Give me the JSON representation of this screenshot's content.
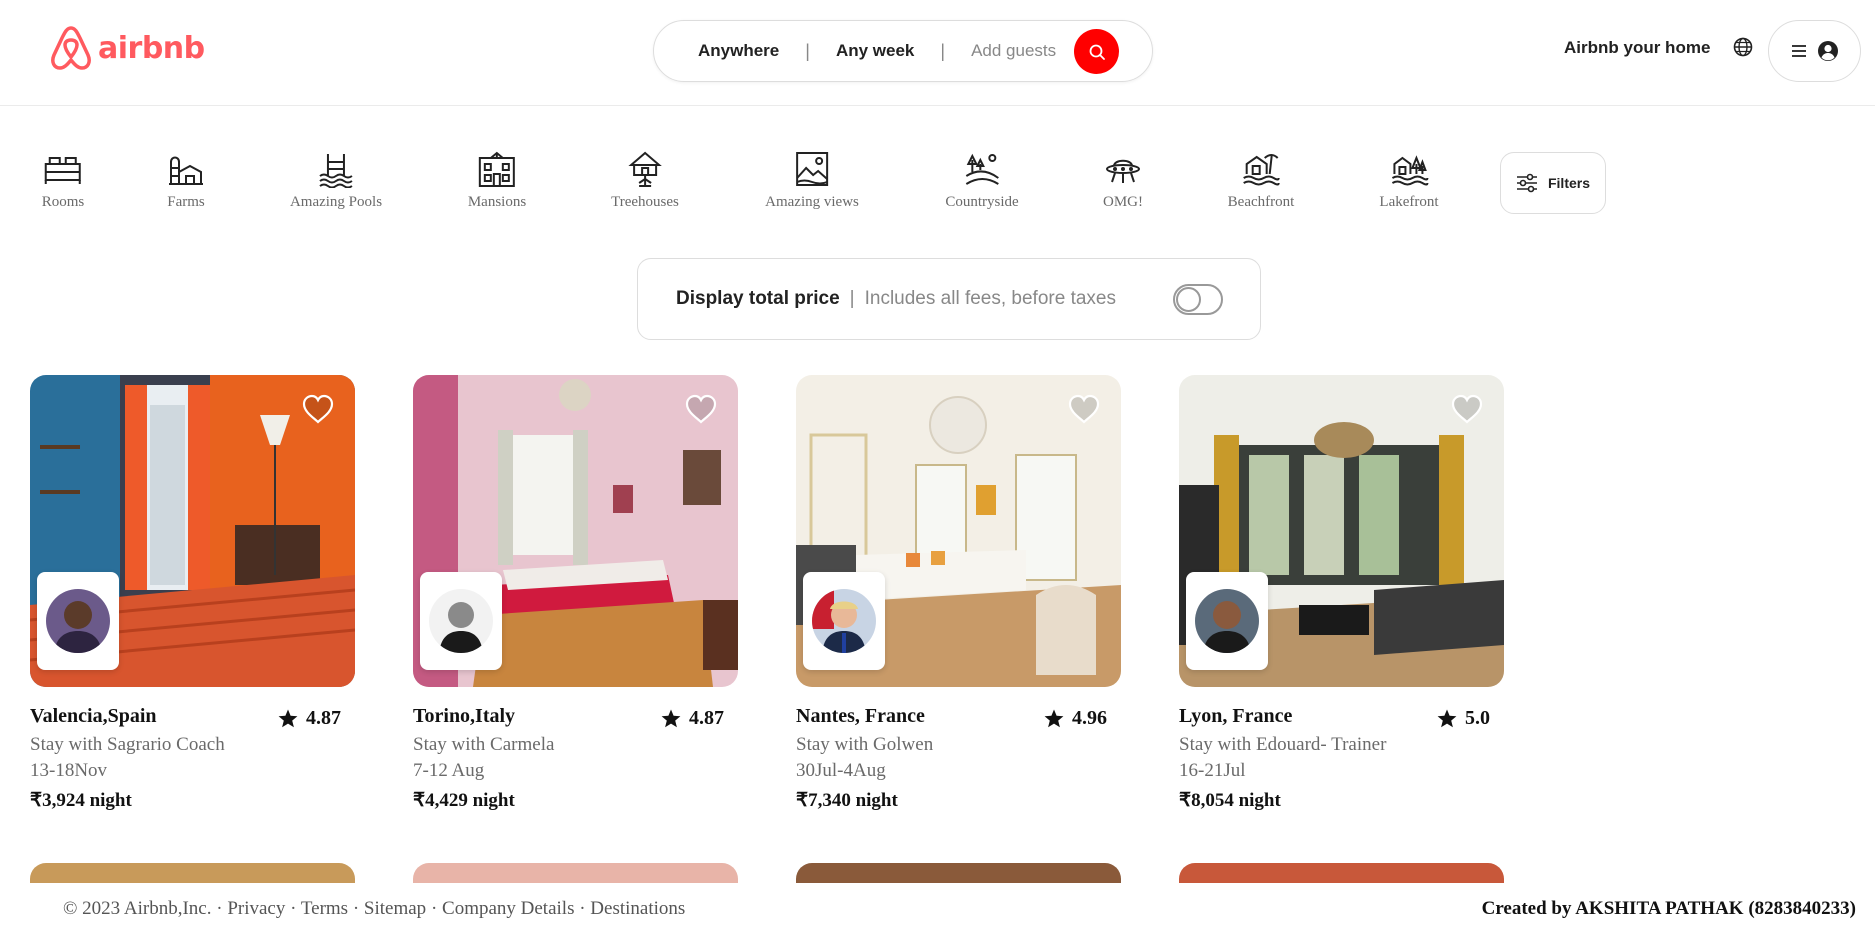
{
  "brand": {
    "name": "airbnb",
    "color": "#ff5a5f"
  },
  "search": {
    "where": "Anywhere",
    "when": "Any week",
    "guests_placeholder": "Add guests",
    "sep": "|",
    "button_color": "#ff0000"
  },
  "header": {
    "host_link": "Airbnb your home",
    "globe_icon": "globe-icon",
    "menu_icon": "hamburger-icon",
    "user_icon": "user-circle-icon"
  },
  "categories": [
    {
      "label": "Rooms",
      "icon": "rooms-icon"
    },
    {
      "label": "Farms",
      "icon": "farms-icon"
    },
    {
      "label": "Amazing Pools",
      "icon": "pools-icon"
    },
    {
      "label": "Mansions",
      "icon": "mansions-icon"
    },
    {
      "label": "Treehouses",
      "icon": "treehouses-icon"
    },
    {
      "label": "Amazing views",
      "icon": "views-icon"
    },
    {
      "label": "Countryside",
      "icon": "countryside-icon"
    },
    {
      "label": "OMG!",
      "icon": "omg-icon"
    },
    {
      "label": "Beachfront",
      "icon": "beachfront-icon"
    },
    {
      "label": "Lakefront",
      "icon": "lakefront-icon"
    }
  ],
  "filters": {
    "label": "Filters"
  },
  "price_display": {
    "label": "Display total price",
    "sep": "|",
    "description": "Includes all fees, before taxes",
    "enabled": false
  },
  "listings": [
    {
      "location": "Valencia,Spain",
      "rating": "4.87",
      "host": "Stay with Sagrario Coach",
      "dates": "13-18Nov",
      "price": "₹3,924 night"
    },
    {
      "location": "Torino,Italy",
      "rating": "4.87",
      "host": "Stay with Carmela",
      "dates": "7-12 Aug",
      "price": "₹4,429 night"
    },
    {
      "location": "Nantes, France",
      "rating": "4.96",
      "host": "Stay with Golwen",
      "dates": "30Jul-4Aug",
      "price": "₹7,340 night"
    },
    {
      "location": "Lyon, France",
      "rating": "5.0",
      "host": "Stay with Edouard- Trainer",
      "dates": "16-21Jul",
      "price": "₹8,054 night"
    }
  ],
  "footer": {
    "copyright": "© 2023 Airbnb,Inc.",
    "links": [
      "Privacy",
      "Terms",
      "Sitemap",
      "Company Details",
      "Destinations"
    ],
    "dot": "·",
    "credit": "Created by AKSHITA PATHAK (8283840233)"
  }
}
